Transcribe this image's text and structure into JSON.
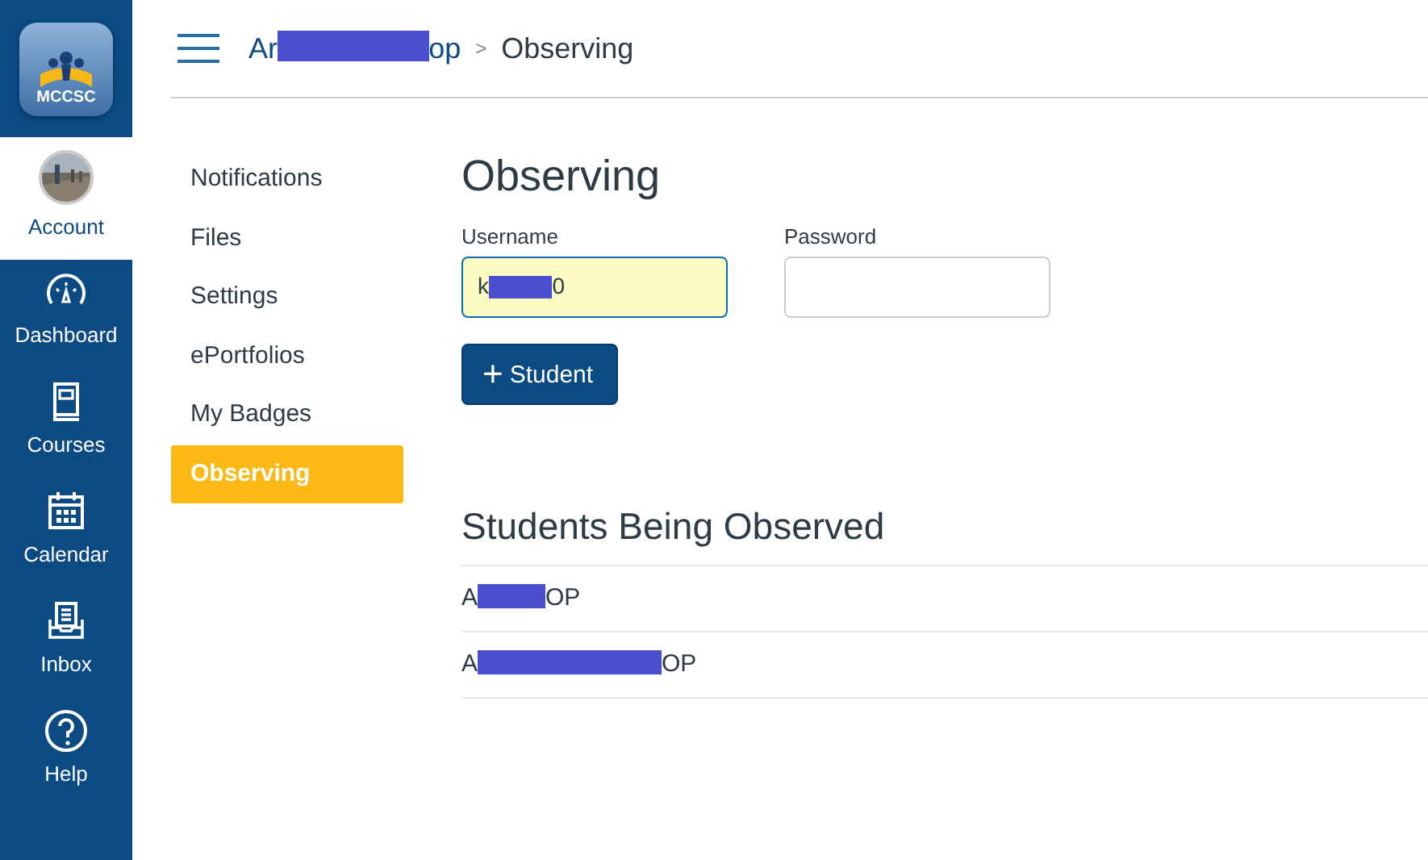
{
  "logo": {
    "text": "MCCSC"
  },
  "global_nav": [
    {
      "label": "Account",
      "kind": "avatar",
      "selected": true
    },
    {
      "label": "Dashboard",
      "kind": "dashboard",
      "selected": false
    },
    {
      "label": "Courses",
      "kind": "courses",
      "selected": false
    },
    {
      "label": "Calendar",
      "kind": "calendar",
      "selected": false
    },
    {
      "label": "Inbox",
      "kind": "inbox",
      "selected": false
    },
    {
      "label": "Help",
      "kind": "help",
      "selected": false
    }
  ],
  "breadcrumb": [
    {
      "start": "Ar",
      "kind": "medium",
      "end": "op"
    },
    {
      "text": "Observing"
    }
  ],
  "breadcrumb_separator": ">",
  "sidebar": {
    "items": [
      {
        "label": "Notifications",
        "selected": false
      },
      {
        "label": "Files",
        "selected": false
      },
      {
        "label": "Settings",
        "selected": false
      },
      {
        "label": "ePortfolios",
        "selected": false
      },
      {
        "label": "My Badges",
        "selected": false
      },
      {
        "label": "Observing",
        "selected": true
      }
    ]
  },
  "page_title": "Observing",
  "form": {
    "username": {
      "label": "Username",
      "start": "k",
      "kind": "short",
      "end": "0"
    },
    "password": {
      "label": "Password"
    },
    "add_button": {
      "icon": "+",
      "label": "Student"
    }
  },
  "students_heading": "Students Being Observed",
  "students": [
    {
      "start": "A",
      "kind": "short",
      "end": "OP"
    },
    {
      "start": "A",
      "kind": "long",
      "end": "OP"
    }
  ]
}
